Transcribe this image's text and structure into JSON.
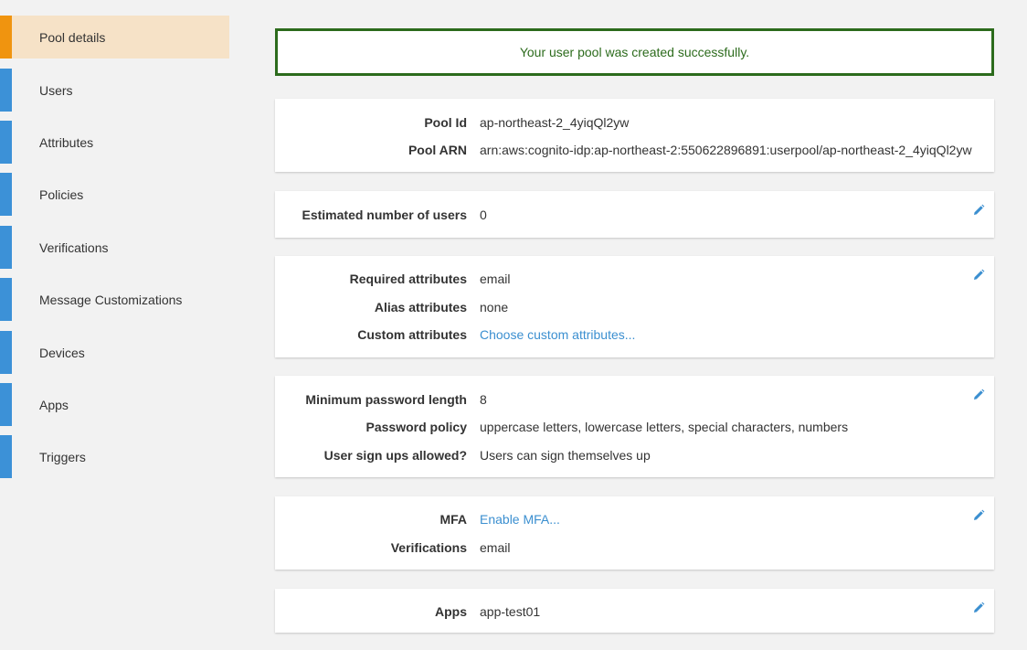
{
  "sidebar": {
    "items": [
      {
        "label": "Pool details",
        "active": true
      },
      {
        "label": "Users"
      },
      {
        "label": "Attributes"
      },
      {
        "label": "Policies"
      },
      {
        "label": "Verifications"
      },
      {
        "label": "Message Customizations"
      },
      {
        "label": "Devices"
      },
      {
        "label": "Apps"
      },
      {
        "label": "Triggers"
      }
    ]
  },
  "banner": {
    "message": "Your user pool was created successfully."
  },
  "general": {
    "pool_id_label": "Pool Id",
    "pool_id": "ap-northeast-2_4yiqQl2yw",
    "pool_arn_label": "Pool ARN",
    "pool_arn": "arn:aws:cognito-idp:ap-northeast-2:550622896891:userpool/ap-northeast-2_4yiqQl2yw"
  },
  "users": {
    "estimated_label": "Estimated number of users",
    "estimated": "0"
  },
  "attributes": {
    "required_label": "Required attributes",
    "required": "email",
    "alias_label": "Alias attributes",
    "alias": "none",
    "custom_label": "Custom attributes",
    "custom_link": "Choose custom attributes..."
  },
  "policies": {
    "min_len_label": "Minimum password length",
    "min_len": "8",
    "policy_label": "Password policy",
    "policy": "uppercase letters, lowercase letters, special characters, numbers",
    "signup_label": "User sign ups allowed?",
    "signup": "Users can sign themselves up"
  },
  "mfa": {
    "mfa_label": "MFA",
    "mfa_link": "Enable MFA...",
    "verif_label": "Verifications",
    "verif": "email"
  },
  "apps": {
    "apps_label": "Apps",
    "apps": "app-test01"
  },
  "colors": {
    "accent": "#3c91d7",
    "active": "#f0940f",
    "success": "#2c6b1c",
    "link": "#3b8fd0"
  }
}
